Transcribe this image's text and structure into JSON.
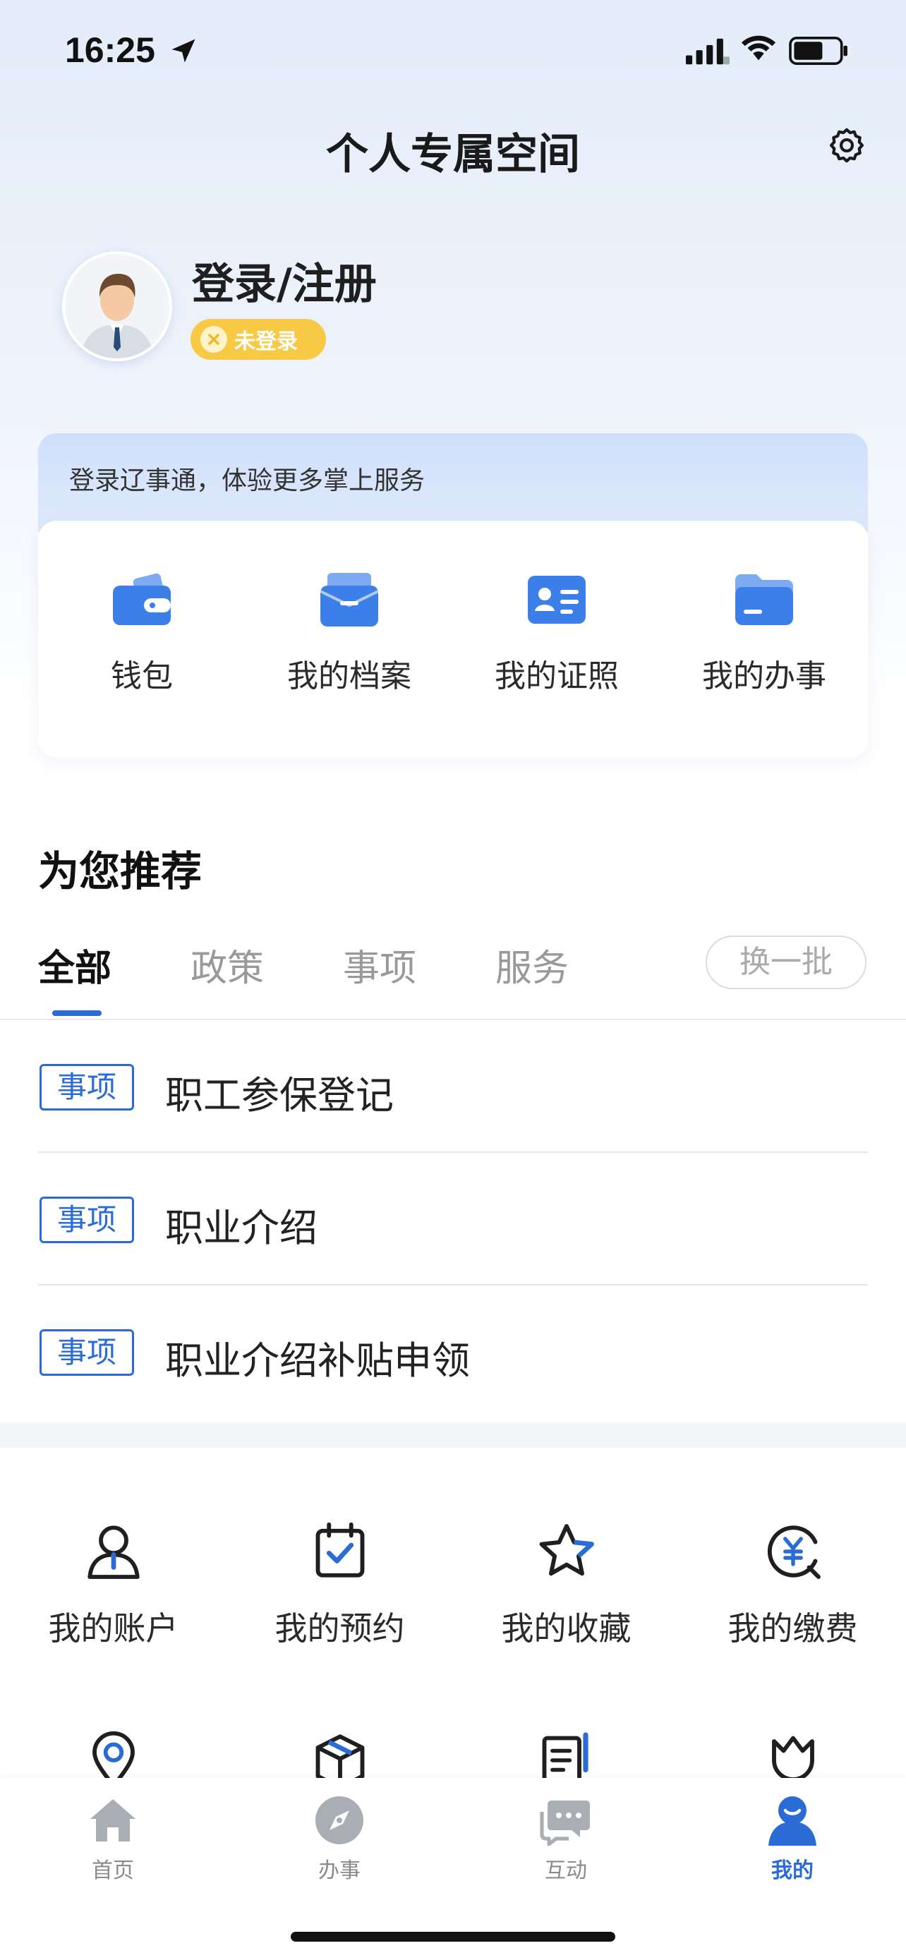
{
  "status_bar": {
    "time": "16:25"
  },
  "header": {
    "title": "个人专属空间"
  },
  "profile": {
    "name": "登录/注册",
    "badge": "未登录"
  },
  "login_banner": {
    "text": "登录辽事通，体验更多掌上服务"
  },
  "quick_actions": [
    {
      "label": "钱包",
      "icon": "wallet-icon"
    },
    {
      "label": "我的档案",
      "icon": "archive-icon"
    },
    {
      "label": "我的证照",
      "icon": "id-card-icon"
    },
    {
      "label": "我的办事",
      "icon": "folder-icon"
    }
  ],
  "recommend": {
    "title": "为您推荐",
    "tabs": [
      "全部",
      "政策",
      "事项",
      "服务"
    ],
    "refresh_label": "换一批",
    "items": [
      {
        "tag": "事项",
        "title": "职工参保登记"
      },
      {
        "tag": "事项",
        "title": "职业介绍"
      },
      {
        "tag": "事项",
        "title": "职业介绍补贴申领"
      }
    ]
  },
  "services": [
    {
      "label": "我的账户",
      "icon": "account-icon"
    },
    {
      "label": "我的预约",
      "icon": "calendar-check-icon"
    },
    {
      "label": "我的收藏",
      "icon": "star-icon"
    },
    {
      "label": "我的缴费",
      "icon": "payment-icon"
    }
  ],
  "services_row2_icons": [
    "location-icon",
    "box-icon",
    "document-pen-icon",
    "tulip-icon"
  ],
  "tabbar": [
    {
      "label": "首页",
      "icon": "home-icon"
    },
    {
      "label": "办事",
      "icon": "compass-icon"
    },
    {
      "label": "互动",
      "icon": "chat-icon"
    },
    {
      "label": "我的",
      "icon": "profile-icon",
      "active": true
    }
  ],
  "colors": {
    "accent": "#2a6bd6",
    "badge": "#f7c945"
  }
}
